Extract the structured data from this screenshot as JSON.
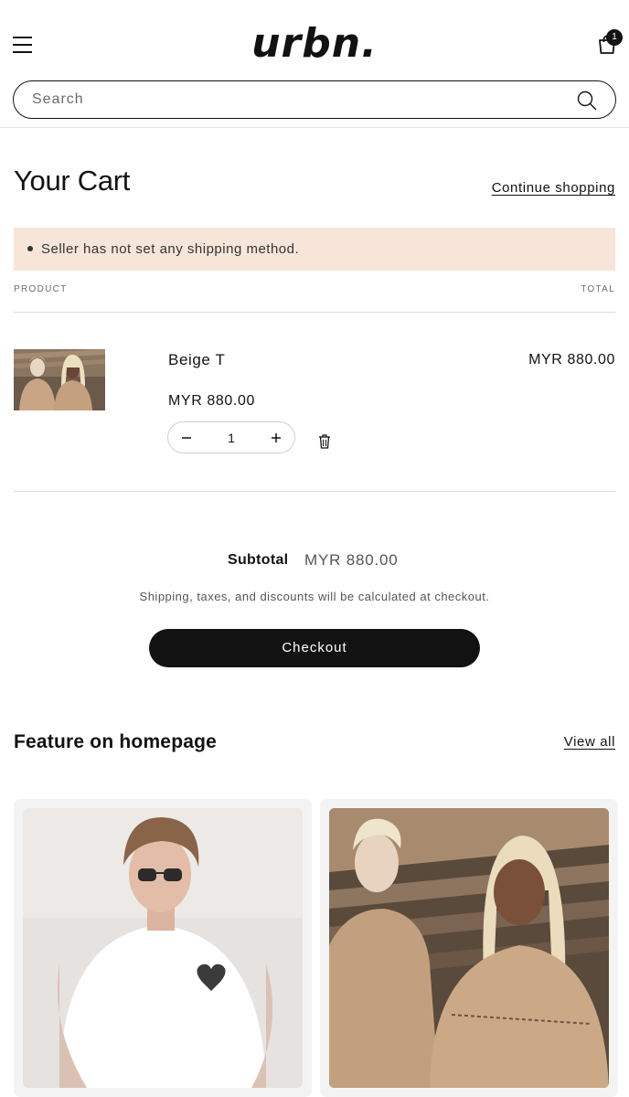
{
  "header": {
    "logo": "urbn.",
    "cart_count": "1",
    "search_placeholder": "Search"
  },
  "cart": {
    "title": "Your Cart",
    "continue_label": "Continue shopping",
    "notice": "Seller has not set any shipping method.",
    "col_product": "PRODUCT",
    "col_total": "TOTAL",
    "item": {
      "name": "Beige T",
      "price": "MYR 880.00",
      "total": "MYR 880.00",
      "quantity": "1"
    }
  },
  "summary": {
    "subtotal_label": "Subtotal",
    "subtotal_value": "MYR 880.00",
    "tax_note": "Shipping, taxes, and discounts will be calculated at checkout.",
    "checkout_label": "Checkout"
  },
  "featured": {
    "title": "Feature on homepage",
    "view_all_label": "View all"
  },
  "colors": {
    "notice_bg": "#f8e5da",
    "button_bg": "#121212",
    "text": "#121212"
  }
}
